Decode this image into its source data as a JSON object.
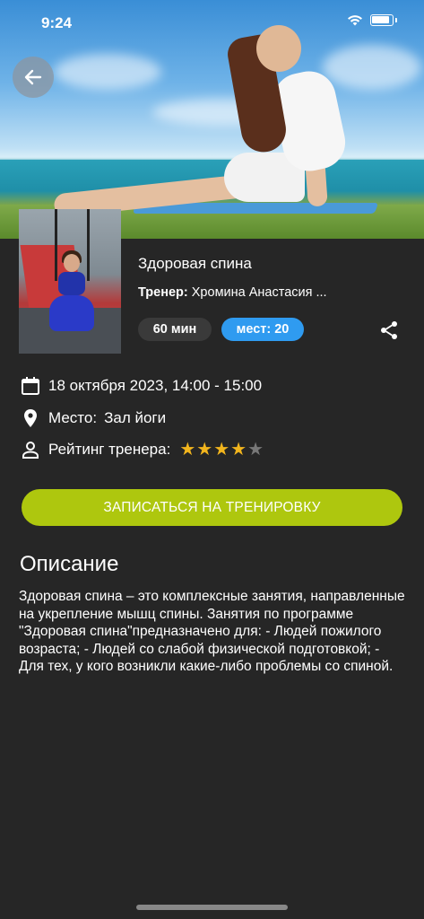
{
  "status_bar": {
    "time": "9:24"
  },
  "class": {
    "title": "Здоровая спина",
    "trainer_label": "Тренер:",
    "trainer_name": "Хромина Анастасия ...",
    "duration": "60 мин",
    "seats": "мест: 20"
  },
  "details": {
    "datetime": "18 октября 2023, 14:00 - 15:00",
    "place_label": "Место:",
    "place_value": "Зал йоги",
    "rating_label": "Рейтинг тренера:",
    "rating": 4,
    "rating_max": 5
  },
  "cta_label": "ЗАПИСАТЬСЯ НА ТРЕНИРОВКУ",
  "description": {
    "heading": "Описание",
    "text": "Здоровая спина – это комплексные занятия, направленные на укрепление мышц спины. Занятия по программе \"Здоровая спина\"предназначено для: - Людей пожилого возраста; - Людей со слабой физической подготовкой; - Для тех, у кого возникли какие-либо проблемы со спиной."
  },
  "colors": {
    "background": "#262626",
    "cta": "#aec70e",
    "seats_chip": "#2f9bf0",
    "duration_chip": "#3a3a3a",
    "star_on": "#f2b51d",
    "star_off": "#777777"
  },
  "icons": {
    "back": "arrow-left-icon",
    "share": "share-icon",
    "date": "calendar-icon",
    "place": "location-pin-icon",
    "rating": "person-icon"
  }
}
